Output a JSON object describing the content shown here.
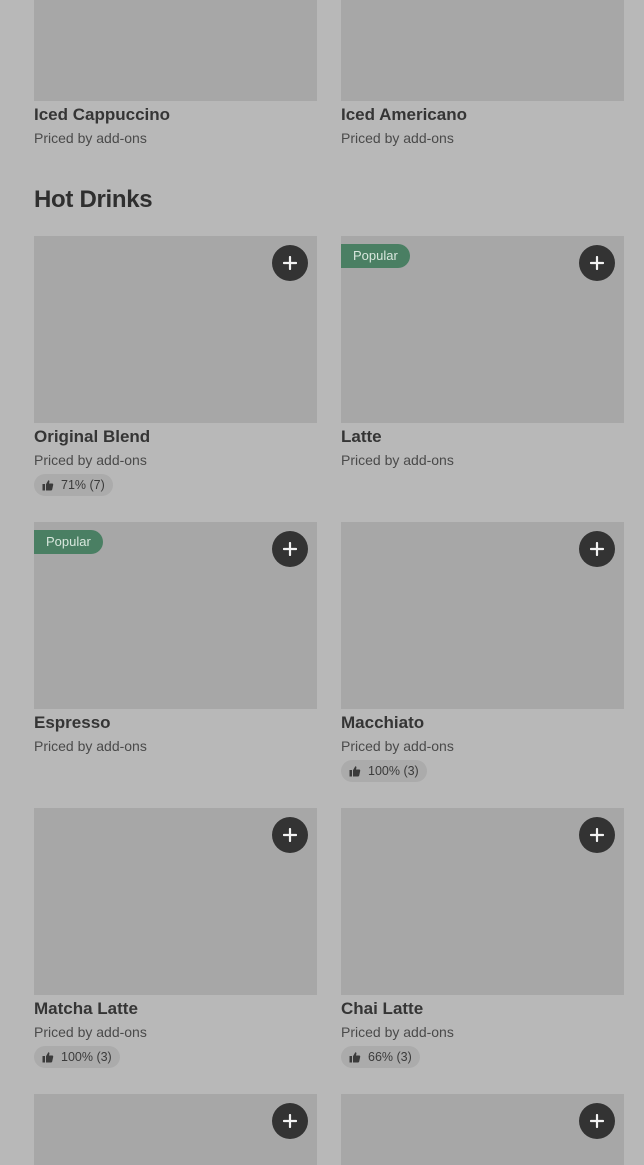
{
  "top_items": [
    {
      "name": "Iced Cappuccino",
      "price": "Priced by add-ons"
    },
    {
      "name": "Iced Americano",
      "price": "Priced by add-ons"
    }
  ],
  "section": {
    "title": "Hot Drinks"
  },
  "items": [
    {
      "name": "Original Blend",
      "price": "Priced by add-ons",
      "rating": "71% (7)"
    },
    {
      "name": "Latte",
      "price": "Priced by add-ons",
      "badge": "Popular"
    },
    {
      "name": "Espresso",
      "price": "Priced by add-ons",
      "badge": "Popular"
    },
    {
      "name": "Macchiato",
      "price": "Priced by add-ons",
      "rating": "100% (3)"
    },
    {
      "name": "Matcha Latte",
      "price": "Priced by add-ons",
      "rating": "100% (3)"
    },
    {
      "name": "Chai Latte",
      "price": "Priced by add-ons",
      "rating": "66% (3)"
    }
  ],
  "icons": {
    "add": "plus-icon",
    "rating": "thumbs-up-icon"
  },
  "colors": {
    "background": "#b8b8b8",
    "image_placeholder": "#a7a7a7",
    "add_button": "#333333",
    "badge": "#4a7f63",
    "rating_pill": "#ababab"
  }
}
